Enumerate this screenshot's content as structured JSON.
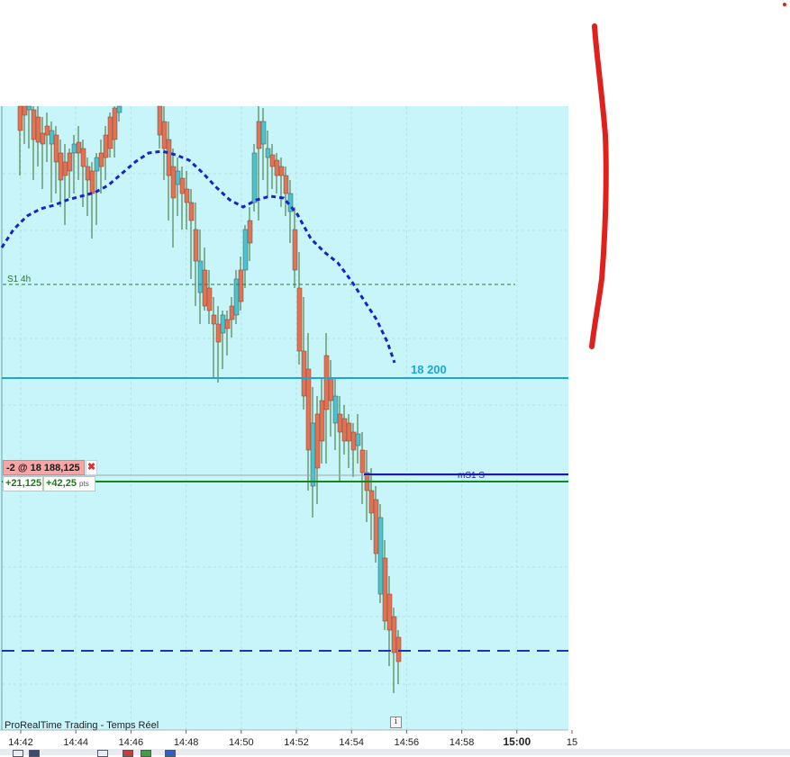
{
  "chart": {
    "type": "candlestick",
    "x_axis": {
      "ticks": [
        {
          "label": "14:42",
          "bold": false
        },
        {
          "label": "14:44",
          "bold": false
        },
        {
          "label": "14:46",
          "bold": false
        },
        {
          "label": "14:48",
          "bold": false
        },
        {
          "label": "14:50",
          "bold": false
        },
        {
          "label": "14:52",
          "bold": false
        },
        {
          "label": "14:54",
          "bold": false
        },
        {
          "label": "14:56",
          "bold": false
        },
        {
          "label": "14:58",
          "bold": false
        },
        {
          "label": "15:00",
          "bold": true
        },
        {
          "label": "15",
          "bold": false
        }
      ]
    },
    "levels": {
      "s1_4h_label": "S1 4h",
      "level_18200_label": "18 200",
      "ms1_label": "mS1 S"
    },
    "colors": {
      "background": "#c8f5fa",
      "bull": "#45c4d2",
      "bear": "#e27254",
      "wick": "#3a6a2a",
      "moving_average": "#1a22c8",
      "level_18200": "#1aa6d6",
      "s1": "#2a7a2a",
      "ms1": "#1a1ab0",
      "order_line": "#17861a",
      "target_line": "#2233bb",
      "annotation": "#e0201c"
    }
  },
  "position": {
    "label": "-2 @ 18 188,125",
    "close_icon": "close-icon",
    "pl_value": "+21,125",
    "pl_points": "+42,25",
    "pl_unit": "pts"
  },
  "footer": {
    "platform_label": "ProRealTime Trading - Temps Réel",
    "info_icon": "info-icon"
  }
}
